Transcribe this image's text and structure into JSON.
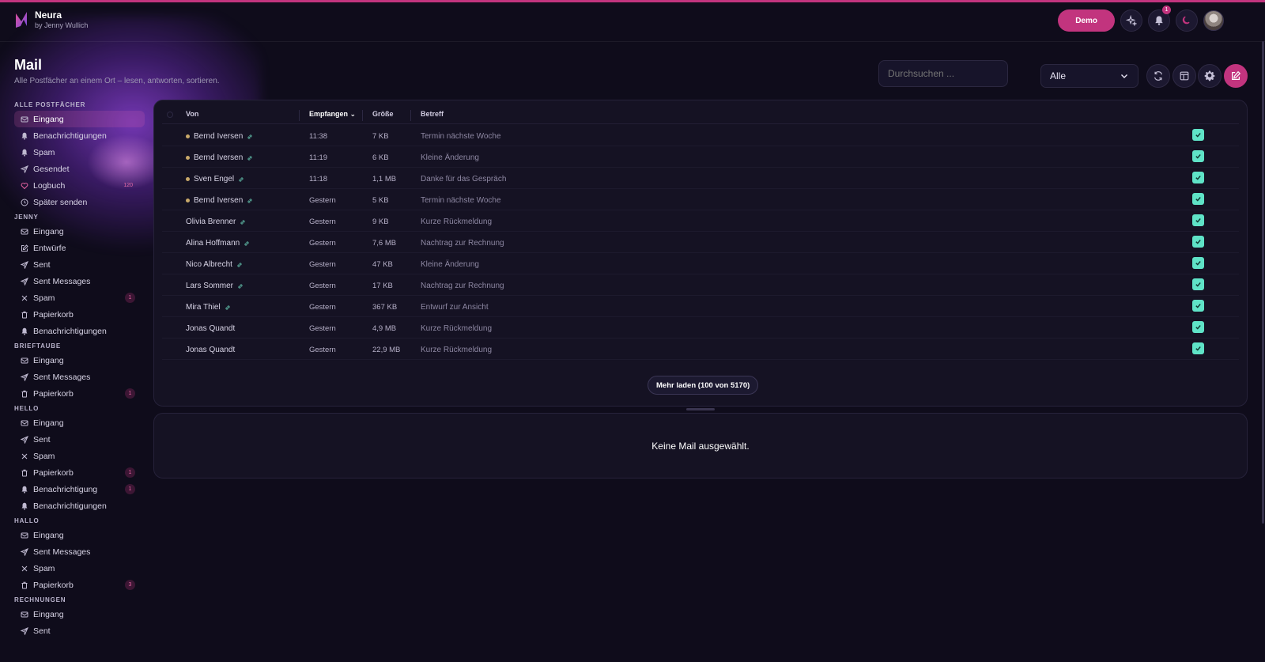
{
  "app": {
    "name": "Neura",
    "subtitle": "by Jenny Wullich",
    "demo_label": "Demo",
    "notification_count": "1"
  },
  "page": {
    "title": "Mail",
    "subtitle": "Alle Postfächer an einem Ort – lesen, antworten, sortieren."
  },
  "toolbar": {
    "search_placeholder": "Durchsuchen ...",
    "filter_value": "Alle"
  },
  "sidebar": [
    {
      "title": "Alle Postfächer",
      "items": [
        {
          "label": "Eingang",
          "icon": "inbox-icon",
          "active": true
        },
        {
          "label": "Benachrichtigungen",
          "icon": "bell-icon"
        },
        {
          "label": "Spam",
          "icon": "bell-icon"
        },
        {
          "label": "Gesendet",
          "icon": "send-icon"
        },
        {
          "label": "Logbuch",
          "icon": "heart-icon",
          "count": "120"
        },
        {
          "label": "Später senden",
          "icon": "clock-icon"
        }
      ]
    },
    {
      "title": "Jenny",
      "items": [
        {
          "label": "Eingang",
          "icon": "inbox-icon"
        },
        {
          "label": "Entwürfe",
          "icon": "edit-icon"
        },
        {
          "label": "Sent",
          "icon": "send-icon"
        },
        {
          "label": "Sent Messages",
          "icon": "send-icon"
        },
        {
          "label": "Spam",
          "icon": "x-icon",
          "count": "1"
        },
        {
          "label": "Papierkorb",
          "icon": "trash-icon"
        },
        {
          "label": "Benachrichtigungen",
          "icon": "bell-icon"
        }
      ]
    },
    {
      "title": "Brieftaube",
      "items": [
        {
          "label": "Eingang",
          "icon": "inbox-icon"
        },
        {
          "label": "Sent Messages",
          "icon": "send-icon"
        },
        {
          "label": "Papierkorb",
          "icon": "trash-icon",
          "count": "1"
        }
      ]
    },
    {
      "title": "Hello",
      "items": [
        {
          "label": "Eingang",
          "icon": "inbox-icon"
        },
        {
          "label": "Sent",
          "icon": "send-icon"
        },
        {
          "label": "Spam",
          "icon": "x-icon"
        },
        {
          "label": "Papierkorb",
          "icon": "trash-icon",
          "count": "1"
        },
        {
          "label": "Benachrichtigung",
          "icon": "bell-icon",
          "count": "1"
        },
        {
          "label": "Benachrichtigungen",
          "icon": "bell-icon"
        }
      ]
    },
    {
      "title": "Hallo",
      "items": [
        {
          "label": "Eingang",
          "icon": "inbox-icon"
        },
        {
          "label": "Sent Messages",
          "icon": "send-icon"
        },
        {
          "label": "Spam",
          "icon": "x-icon"
        },
        {
          "label": "Papierkorb",
          "icon": "trash-icon",
          "count": "3"
        }
      ]
    },
    {
      "title": "Rechnungen",
      "items": [
        {
          "label": "Eingang",
          "icon": "inbox-icon"
        },
        {
          "label": "Sent",
          "icon": "send-icon"
        }
      ]
    }
  ],
  "table": {
    "columns": {
      "from": "Von",
      "received": "Empfangen",
      "size": "Größe",
      "subject": "Betreff"
    },
    "rows": [
      {
        "from": "Bernd Iversen",
        "unread": true,
        "linked": true,
        "received": "11:38",
        "size": "7 KB",
        "subject": "Termin nächste Woche"
      },
      {
        "from": "Bernd Iversen",
        "unread": true,
        "linked": true,
        "received": "11:19",
        "size": "6 KB",
        "subject": "Kleine Änderung"
      },
      {
        "from": "Sven Engel",
        "unread": true,
        "linked": true,
        "received": "11:18",
        "size": "1,1 MB",
        "subject": "Danke für das Gespräch"
      },
      {
        "from": "Bernd Iversen",
        "unread": true,
        "linked": true,
        "received": "Gestern",
        "size": "5 KB",
        "subject": "Termin nächste Woche"
      },
      {
        "from": "Olivia Brenner",
        "unread": false,
        "linked": true,
        "received": "Gestern",
        "size": "9 KB",
        "subject": "Kurze Rückmeldung"
      },
      {
        "from": "Alina Hoffmann",
        "unread": false,
        "linked": true,
        "received": "Gestern",
        "size": "7,6 MB",
        "subject": "Nachtrag zur Rechnung"
      },
      {
        "from": "Nico Albrecht",
        "unread": false,
        "linked": true,
        "received": "Gestern",
        "size": "47 KB",
        "subject": "Kleine Änderung"
      },
      {
        "from": "Lars Sommer",
        "unread": false,
        "linked": true,
        "received": "Gestern",
        "size": "17 KB",
        "subject": "Nachtrag zur Rechnung"
      },
      {
        "from": "Mira Thiel",
        "unread": false,
        "linked": true,
        "received": "Gestern",
        "size": "367 KB",
        "subject": "Entwurf zur Ansicht"
      },
      {
        "from": "Jonas Quandt",
        "unread": false,
        "linked": false,
        "received": "Gestern",
        "size": "4,9 MB",
        "subject": "Kurze Rückmeldung"
      },
      {
        "from": "Jonas Quandt",
        "unread": false,
        "linked": false,
        "received": "Gestern",
        "size": "22,9 MB",
        "subject": "Kurze Rückmeldung"
      }
    ],
    "load_more_label": "Mehr laden (100 von 5170)"
  },
  "preview": {
    "empty_text": "Keine Mail ausgewählt."
  },
  "colors": {
    "accent": "#c2347e",
    "check": "#5fe3c7",
    "background": "#0f0c1b",
    "panel": "#151223"
  }
}
